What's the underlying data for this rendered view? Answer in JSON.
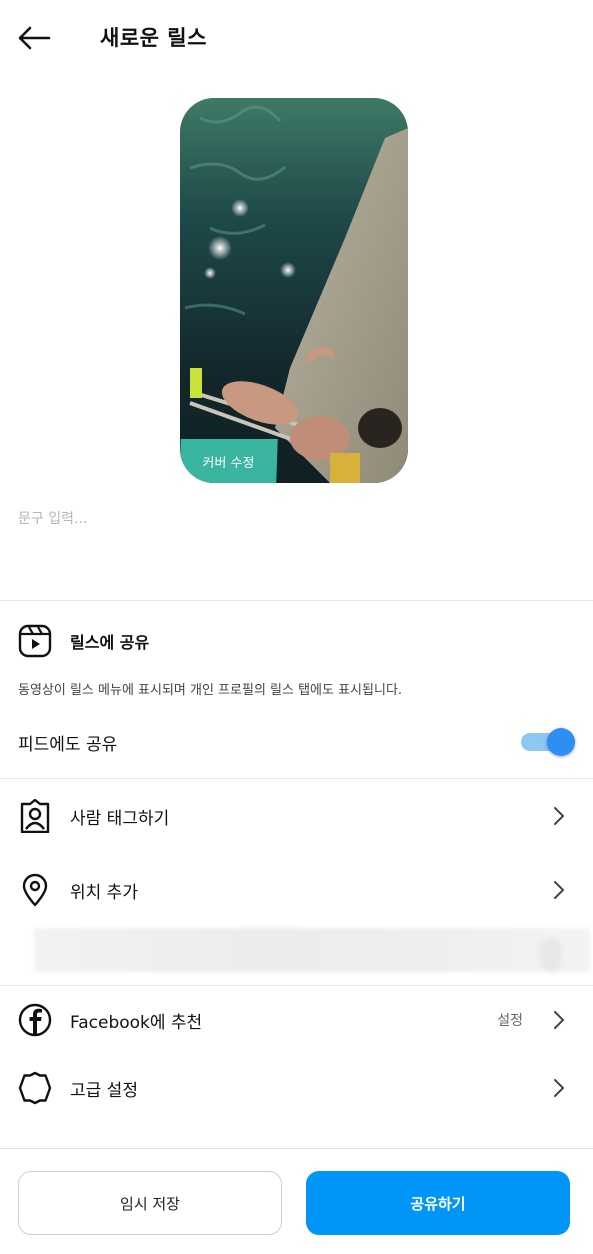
{
  "header": {
    "title": "새로운 릴스",
    "back_icon": "arrow-left-icon"
  },
  "cover": {
    "edit_label": "커버 수정"
  },
  "caption": {
    "placeholder": "문구 입력..."
  },
  "reels_share": {
    "icon": "reels-icon",
    "label": "릴스에 공유",
    "description": "동영상이 릴스 메뉴에 표시되며 개인 프로필의 릴스 탭에도 표시됩니다."
  },
  "feed_share": {
    "label": "피드에도 공유",
    "enabled": true
  },
  "options": [
    {
      "icon": "tag-people-icon",
      "label": "사람 태그하기",
      "value": ""
    },
    {
      "icon": "location-pin-icon",
      "label": "위치 추가",
      "value": ""
    }
  ],
  "options2": [
    {
      "icon": "facebook-icon",
      "label": "Facebook에 추천",
      "value": "설정"
    },
    {
      "icon": "settings-gear-icon",
      "label": "고급 설정",
      "value": ""
    }
  ],
  "footer": {
    "draft_label": "임시 저장",
    "share_label": "공유하기"
  },
  "colors": {
    "accent": "#0095f6",
    "toggle_knob": "#2f8ef3",
    "toggle_track": "#8fc7f3",
    "cover_edit_bg": "#40c9b0"
  }
}
